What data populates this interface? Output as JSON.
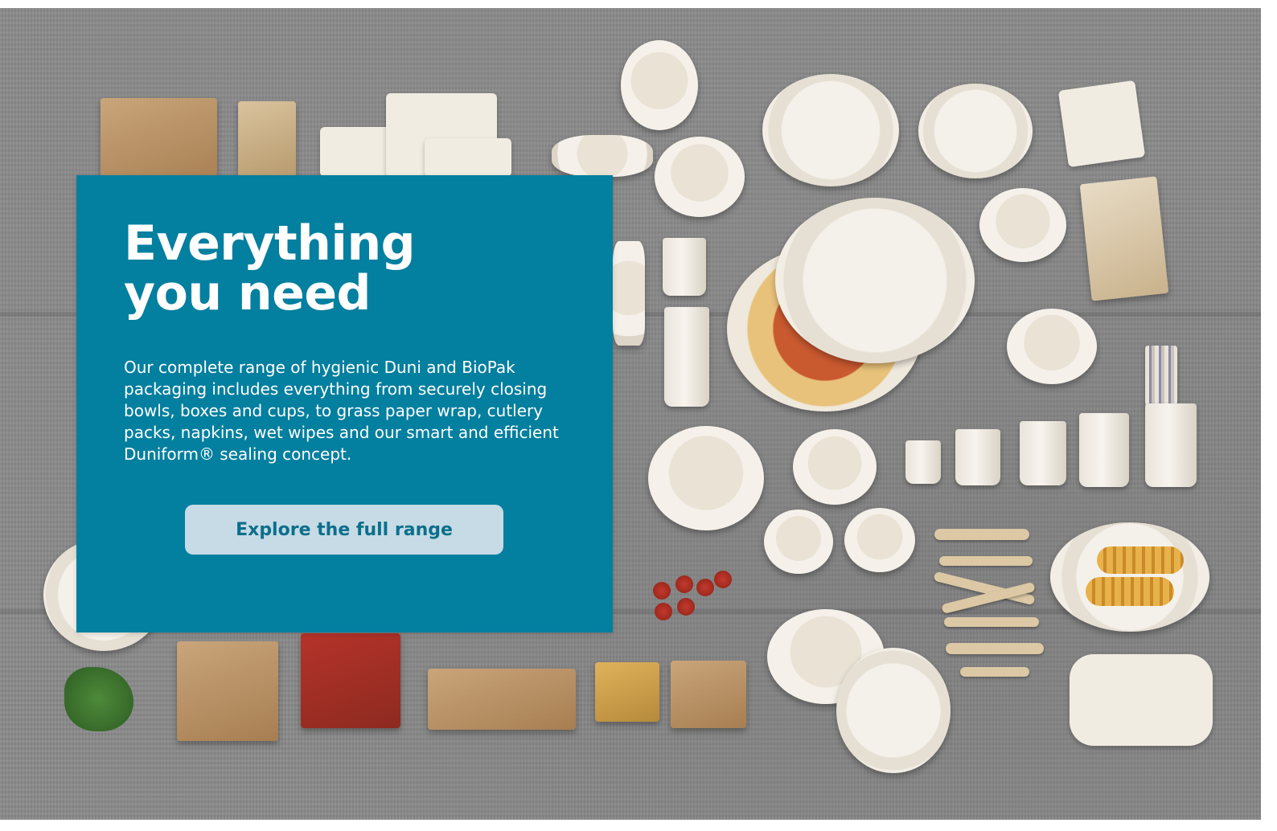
{
  "hero": {
    "image_alt_icon": "product-range-photo",
    "card": {
      "title": "Everything\nyou need",
      "description": "Our complete range of hygienic Duni and BioPak packaging includes everything from securely closing bowls, boxes and cups, to grass paper wrap, cutlery packs, napkins, wet wipes and our smart and efficient Duniform® sealing concept.",
      "cta_label": "Explore the full range"
    }
  },
  "colors": {
    "card_background": "#037f9f",
    "cta_background": "#c6dbe5",
    "cta_text": "#0c6f8c",
    "title_text": "#ffffff"
  }
}
